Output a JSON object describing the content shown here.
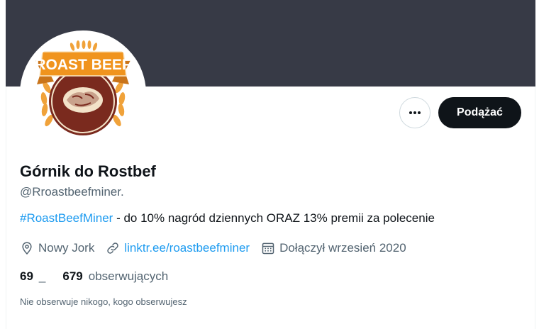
{
  "colors": {
    "banner": "#373a46",
    "accent": "#1d9bf0",
    "text": "#0f1419",
    "secondary_text": "#536471",
    "logo_orange": "#f0941e",
    "logo_brown": "#7a2a1e"
  },
  "avatar": {
    "logo_text": "ROAST BEEF"
  },
  "actions": {
    "more_icon": "more-horizontal-icon",
    "follow_label": "Podążać"
  },
  "profile": {
    "display_name": "Górnik do Rostbef",
    "handle": "@Rroastbeefminer.",
    "bio_hashtag": "#RoastBeefMiner",
    "bio_text": " - do 10% nagród dziennych ORAZ 13% premii za polecenie"
  },
  "meta": {
    "location": "Nowy Jork",
    "location_icon": "location-pin-icon",
    "website": "linktr.ee/roastbeefminer",
    "website_icon": "link-icon",
    "joined": "Dołączył wrzesień 2020",
    "joined_icon": "calendar-icon"
  },
  "stats": {
    "following_count": "69",
    "following_label": "_",
    "followers_count": "679",
    "followers_label": "obserwujących"
  },
  "follow_note": "Nie obserwuje nikogo, kogo obserwujesz"
}
